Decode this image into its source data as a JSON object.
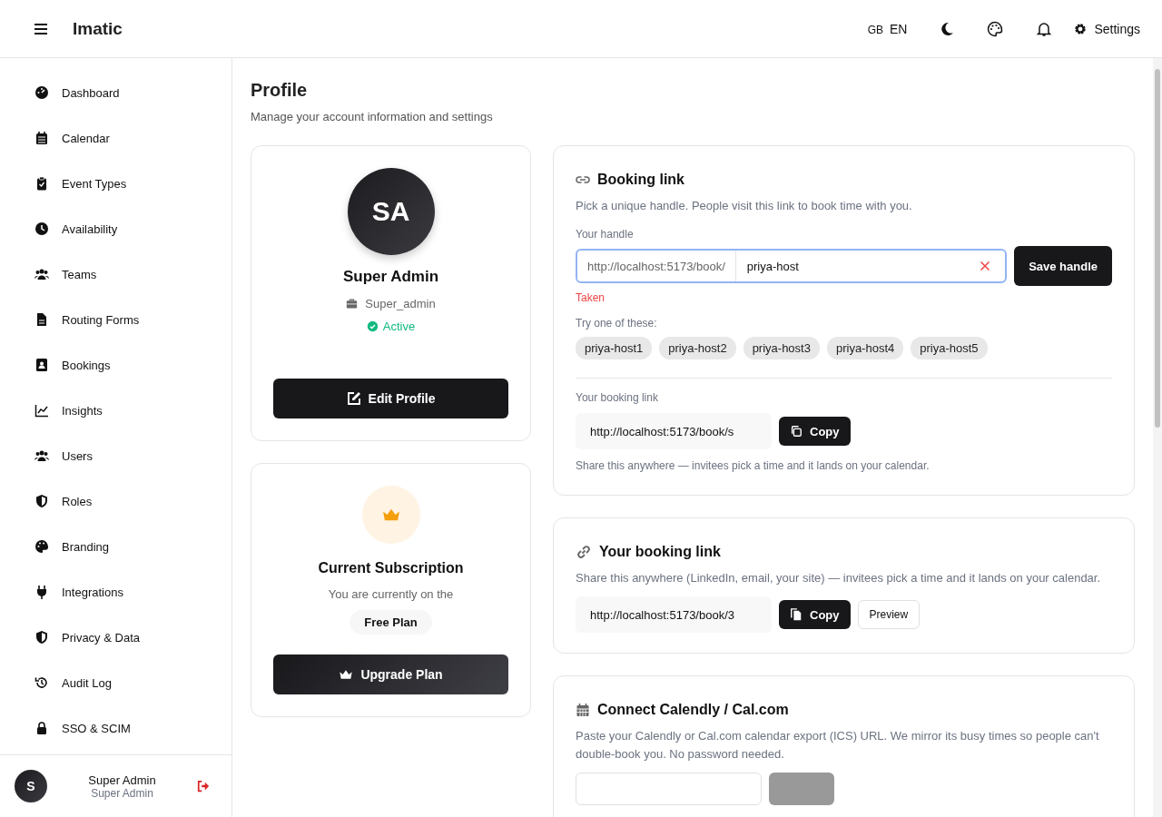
{
  "header": {
    "brand": "Imatic",
    "lang_flag": "GB",
    "lang_code": "EN",
    "settings": "Settings"
  },
  "sidebar": {
    "items": [
      {
        "label": "Dashboard",
        "selected": false
      },
      {
        "label": "Calendar",
        "selected": false
      },
      {
        "label": "Event Types",
        "selected": false
      },
      {
        "label": "Availability",
        "selected": false
      },
      {
        "label": "Teams",
        "selected": false
      },
      {
        "label": "Routing Forms",
        "selected": false
      },
      {
        "label": "Bookings",
        "selected": false
      },
      {
        "label": "Insights",
        "selected": false
      },
      {
        "label": "Users",
        "selected": false
      },
      {
        "label": "Roles",
        "selected": false
      },
      {
        "label": "Branding",
        "selected": false
      },
      {
        "label": "Integrations",
        "selected": false
      },
      {
        "label": "Privacy & Data",
        "selected": false
      },
      {
        "label": "Audit Log",
        "selected": false
      },
      {
        "label": "SSO & SCIM",
        "selected": false
      }
    ],
    "user": {
      "initial": "S",
      "name": "Super Admin",
      "role": "Super Admin"
    }
  },
  "page": {
    "title": "Profile",
    "subtitle": "Manage your account information and settings"
  },
  "profile_card": {
    "initials": "SA",
    "name": "Super Admin",
    "username": "Super_admin",
    "status": "Active",
    "active": true,
    "edit_button": "Edit Profile"
  },
  "subscription_card": {
    "title": "Current Subscription",
    "text": "You are currently on the",
    "plan": "Free Plan",
    "upgrade_button": "Upgrade Plan"
  },
  "booking_link_card": {
    "title": "Booking link",
    "description": "Pick a unique handle. People visit this link to book time with you.",
    "handle_label": "Your handle",
    "handle_prefix": "http://localhost:5173/book/",
    "handle_value": "priya-host",
    "handle_error": "Taken",
    "save_button": "Save handle",
    "suggestions_label": "Try one of these:",
    "suggestions": [
      "priya-host1",
      "priya-host2",
      "priya-host3",
      "priya-host4",
      "priya-host5"
    ],
    "link_label": "Your booking link",
    "link_value": "http://localhost:5173/book/s",
    "copy_button": "Copy",
    "hint": "Share this anywhere — invitees pick a time and it lands on your calendar."
  },
  "share_card": {
    "title": "Your booking link",
    "description": "Share this anywhere (LinkedIn, email, your site) — invitees pick a time and it lands on your calendar.",
    "link_value": "http://localhost:5173/book/3",
    "copy_button": "Copy",
    "preview_button": "Preview"
  },
  "calendly_card": {
    "title": "Connect Calendly / Cal.com",
    "description": "Paste your Calendly or Cal.com calendar export (ICS) URL. We mirror its busy times so people can't double-book you. No password needed.",
    "connect_disabled": true
  }
}
